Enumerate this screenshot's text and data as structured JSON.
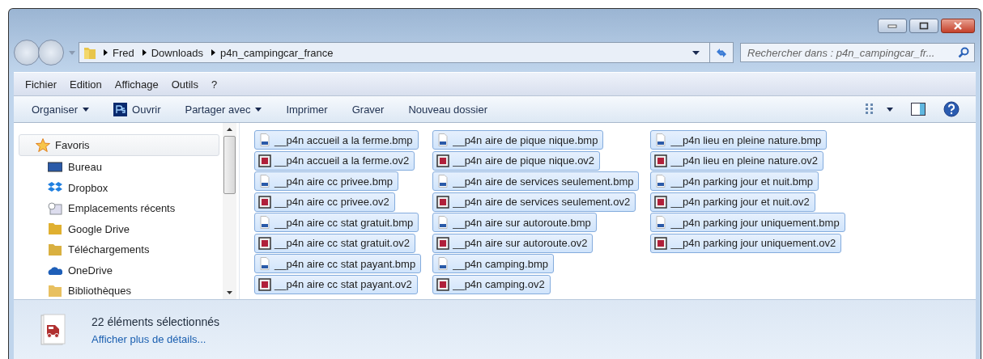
{
  "address_bar": {
    "path": [
      "Fred",
      "Downloads",
      "p4n_campingcar_france"
    ]
  },
  "search": {
    "placeholder": "Rechercher dans : p4n_campingcar_fr..."
  },
  "menu": [
    "Fichier",
    "Edition",
    "Affichage",
    "Outils",
    "?"
  ],
  "toolbar": [
    {
      "label": "Organiser",
      "kind": "dropdown"
    },
    {
      "label": "Ouvrir",
      "kind": "app"
    },
    {
      "label": "Partager avec",
      "kind": "dropdown"
    },
    {
      "label": "Imprimer",
      "kind": "plain"
    },
    {
      "label": "Graver",
      "kind": "plain"
    },
    {
      "label": "Nouveau dossier",
      "kind": "plain"
    }
  ],
  "sidebar": {
    "header": "Favoris",
    "items": [
      {
        "label": "Bureau",
        "kind": "desktop"
      },
      {
        "label": "Dropbox",
        "kind": "dropbox"
      },
      {
        "label": "Emplacements récents",
        "kind": "recent"
      },
      {
        "label": "Google Drive",
        "kind": "gdrive"
      },
      {
        "label": "Téléchargements",
        "kind": "downloads"
      },
      {
        "label": "OneDrive",
        "kind": "onedrive"
      },
      {
        "label": "Bibliothèques",
        "kind": "libraries"
      }
    ]
  },
  "files": [
    {
      "name": "__p4n accueil a la ferme.bmp",
      "kind": "bmp",
      "selected": true
    },
    {
      "name": "__p4n accueil a la ferme.ov2",
      "kind": "ov2",
      "selected": true
    },
    {
      "name": "__p4n aire cc privee.bmp",
      "kind": "bmp",
      "selected": true
    },
    {
      "name": "__p4n aire cc privee.ov2",
      "kind": "ov2",
      "selected": true
    },
    {
      "name": "__p4n aire cc stat gratuit.bmp",
      "kind": "bmp",
      "selected": true
    },
    {
      "name": "__p4n aire cc stat gratuit.ov2",
      "kind": "ov2",
      "selected": true
    },
    {
      "name": "__p4n aire cc stat payant.bmp",
      "kind": "bmp",
      "selected": true
    },
    {
      "name": "__p4n aire cc stat payant.ov2",
      "kind": "ov2",
      "selected": true
    },
    {
      "name": "__p4n aire de pique nique.bmp",
      "kind": "bmp",
      "selected": true
    },
    {
      "name": "__p4n aire de pique nique.ov2",
      "kind": "ov2",
      "selected": true
    },
    {
      "name": "__p4n aire de services seulement.bmp",
      "kind": "bmp",
      "selected": true
    },
    {
      "name": "__p4n aire de services seulement.ov2",
      "kind": "ov2",
      "selected": true
    },
    {
      "name": "__p4n aire sur autoroute.bmp",
      "kind": "bmp",
      "selected": true
    },
    {
      "name": "__p4n aire sur autoroute.ov2",
      "kind": "ov2",
      "selected": true
    },
    {
      "name": "__p4n camping.bmp",
      "kind": "bmp",
      "selected": true
    },
    {
      "name": "__p4n camping.ov2",
      "kind": "ov2",
      "selected": true
    },
    {
      "name": "__p4n lieu en pleine nature.bmp",
      "kind": "bmp",
      "selected": true
    },
    {
      "name": "__p4n lieu en pleine nature.ov2",
      "kind": "ov2",
      "selected": true
    },
    {
      "name": "__p4n parking jour et nuit.bmp",
      "kind": "bmp",
      "selected": true
    },
    {
      "name": "__p4n parking jour et nuit.ov2",
      "kind": "ov2",
      "selected": true
    },
    {
      "name": "__p4n parking jour uniquement.bmp",
      "kind": "bmp",
      "selected": true
    },
    {
      "name": "__p4n parking jour uniquement.ov2",
      "kind": "ov2",
      "selected": true
    }
  ],
  "details": {
    "summary": "22 éléments sélectionnés",
    "link": "Afficher plus de détails..."
  }
}
